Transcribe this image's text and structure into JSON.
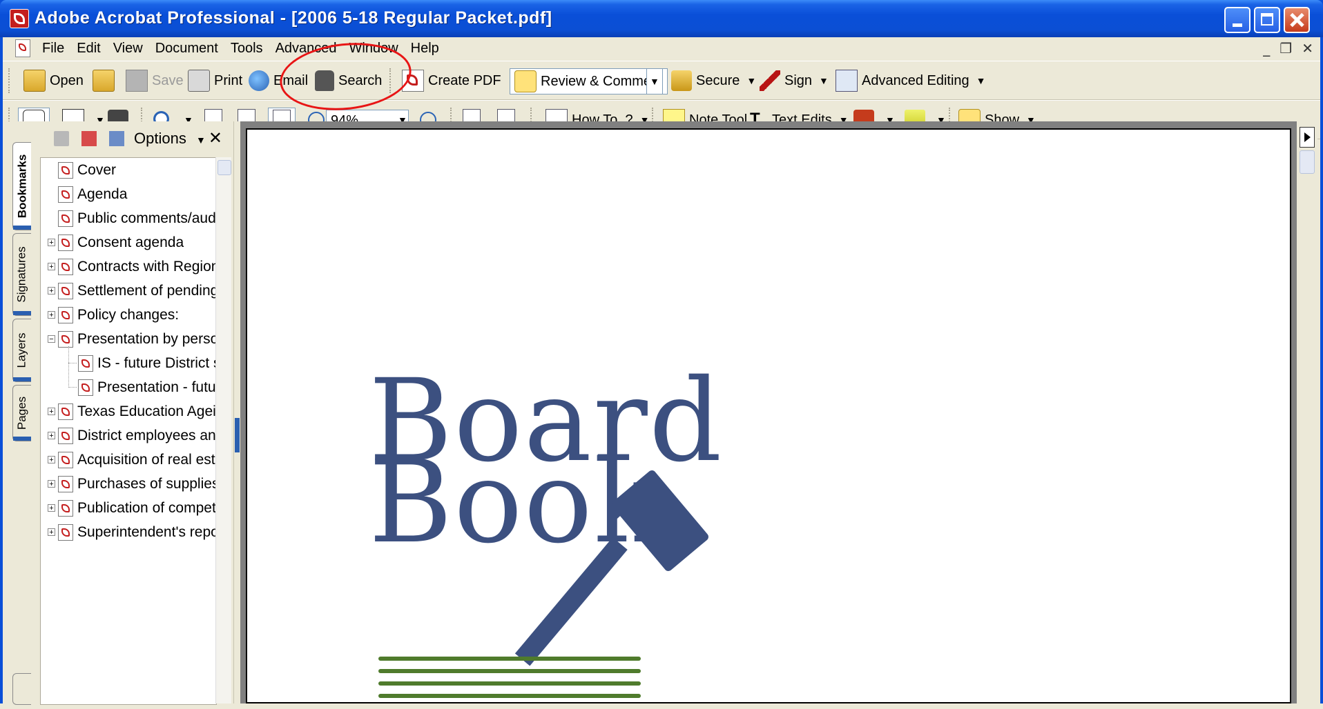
{
  "window": {
    "title": "Adobe Acrobat Professional - [2006 5-18  Regular Packet.pdf]"
  },
  "menu": [
    "File",
    "Edit",
    "View",
    "Document",
    "Tools",
    "Advanced",
    "Window",
    "Help"
  ],
  "toolbar1": {
    "open": "Open",
    "save": "Save",
    "print": "Print",
    "email": "Email",
    "search": "Search",
    "create_pdf": "Create PDF",
    "review_comment": "Review & Comment",
    "secure": "Secure",
    "sign": "Sign",
    "advanced_editing": "Advanced Editing"
  },
  "toolbar2": {
    "zoom_value": "94%",
    "how_to": "How To..?",
    "note_tool": "Note Tool",
    "text_edits": "Text Edits",
    "show": "Show"
  },
  "nav_tabs": [
    "Bookmarks",
    "Signatures",
    "Layers",
    "Pages"
  ],
  "bookmarks_panel": {
    "options_label": "Options",
    "items": [
      {
        "label": "Cover",
        "expander": ""
      },
      {
        "label": "Agenda",
        "expander": ""
      },
      {
        "label": "Public comments/aud",
        "expander": ""
      },
      {
        "label": "Consent agenda",
        "expander": "+"
      },
      {
        "label": "Contracts with Region",
        "expander": "+"
      },
      {
        "label": "Settlement of pending",
        "expander": "+"
      },
      {
        "label": "Policy changes:",
        "expander": "+"
      },
      {
        "label": "Presentation by perso",
        "expander": "-"
      },
      {
        "label": "IS - future District s",
        "expander": "child"
      },
      {
        "label": "Presentation - futur",
        "expander": "child"
      },
      {
        "label": "Texas Education Agei",
        "expander": "+"
      },
      {
        "label": "District employees an",
        "expander": "+"
      },
      {
        "label": "Acquisition of real est",
        "expander": "+"
      },
      {
        "label": "Purchases of supplies",
        "expander": "+"
      },
      {
        "label": "Publication of compet",
        "expander": "+"
      },
      {
        "label": "Superintendent's repo",
        "expander": "+"
      }
    ]
  },
  "document": {
    "logo_line1": "Board",
    "logo_line2": "Book",
    "logo_color": "#3c5080",
    "book_color": "#4f7b2c"
  },
  "annotation": {
    "color": "#e81515",
    "target": "search-button"
  }
}
